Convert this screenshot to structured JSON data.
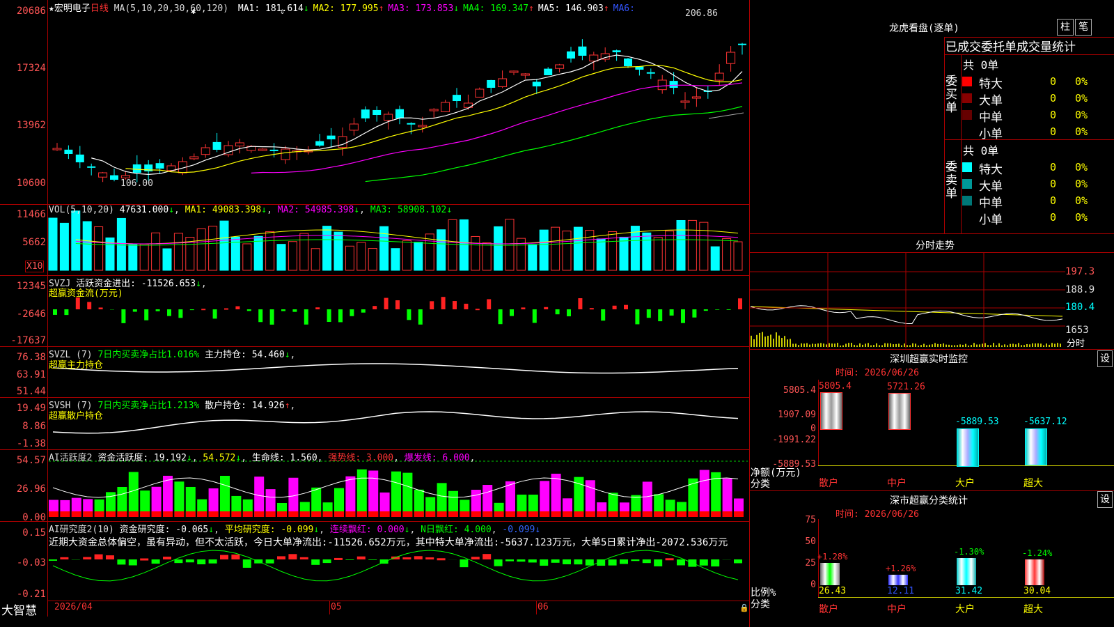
{
  "stock": {
    "star": "★",
    "name": "宏明电子",
    "period": "日线"
  },
  "ma_header": {
    "label": "MA(5,10,20,30,60,120)",
    "items": [
      {
        "text": "MA1: 181.614",
        "arrow": "↓",
        "color": "#ffffff",
        "arrow_color": "#00ff00"
      },
      {
        "text": "MA2: 177.995",
        "arrow": "↑",
        "color": "#ffff00",
        "arrow_color": "#ff3333"
      },
      {
        "text": "MA3: 173.853",
        "arrow": "↓",
        "color": "#ff00ff",
        "arrow_color": "#00ff00"
      },
      {
        "text": "MA4: 169.347",
        "arrow": "↑",
        "color": "#00ff00",
        "arrow_color": "#ff3333"
      },
      {
        "text": "MA5: 146.903",
        "arrow": "↑",
        "color": "#ffffff",
        "arrow_color": "#ff3333"
      },
      {
        "text": "MA6:",
        "arrow": "",
        "color": "#3355ff",
        "arrow_color": "#3355ff"
      }
    ]
  },
  "price_axis": [
    "20686",
    "17324",
    "13962",
    "10600"
  ],
  "price_high_label": "206.86",
  "price_low_label": "106.00",
  "vol": {
    "label": "VOL(5,10,20)",
    "value": "47631.000",
    "arrow": "↓",
    "ma1": "MA1: 49083.398",
    "ma1_arrow": "↓",
    "ma2": "MA2: 54985.398",
    "ma2_arrow": "↓",
    "ma3": "MA3: 58908.102",
    "ma3_arrow": "↓",
    "axis": [
      "11466",
      "5662"
    ],
    "unit": "X10"
  },
  "svzj": {
    "label": "SVZJ",
    "title": "活跃资金进出: -11526.653",
    "arrow": "↓",
    "sub": "超赢资金流(万元)",
    "axis": [
      "12345",
      "-2646",
      "-17637"
    ]
  },
  "svzl": {
    "label": "SVZL (7)",
    "ratio": "7日内买卖净占比1.016%",
    "hold": "主力持仓: 54.460",
    "arrow": "↓",
    "sub": "超赢主力持仓",
    "axis": [
      "76.38",
      "63.91",
      "51.44"
    ]
  },
  "svsh": {
    "label": "SVSH (7)",
    "ratio": "7日内买卖净占比1.213%",
    "hold": "散户持仓: 14.926",
    "arrow": "↑",
    "sub": "超赢散户持仓",
    "axis": [
      "19.49",
      "8.86",
      "-1.38"
    ]
  },
  "ai_active": {
    "label": "AI活跃度2",
    "v1": "资金活跃度: 19.192",
    "a1": "↓",
    "v2": "54.572",
    "a2": "↓",
    "v3": "生命线: 1.560",
    "strong": "强势线: 3.000",
    "burst": "爆发线: 6.000",
    "axis": [
      "54.57",
      "26.96",
      "0.00"
    ]
  },
  "ai_research": {
    "label": "AI研究度2(10)",
    "v1": "资金研究度: -0.065",
    "a1": "↓",
    "v2": "平均研究度: -0.099",
    "a2": "↓",
    "v3": "连续飘红: 0.000",
    "a3": "↓",
    "v4": "N日飘红: 4.000",
    "v5": "-0.099",
    "a5": "↓",
    "desc": "近期大资金总体偏空，虽有异动，但不太活跃，今日大单净流出:-11526.652万元，其中特大单净流出:-5637.123万元，大单5日累计净出-2072.536万元",
    "axis": [
      "0.15",
      "-0.03",
      "-0.21"
    ]
  },
  "bottom": {
    "brand": "大智慧",
    "dates": [
      "2026/04",
      "05",
      "06"
    ]
  },
  "longhu": {
    "title": "龙虎看盘(逐单)",
    "tabs": [
      "柱",
      "笔"
    ],
    "header": "已成交委托单成交量统计",
    "buy": {
      "side": "委买单",
      "total": "共 0单",
      "rows": [
        {
          "name": "特大",
          "val": "0",
          "pct": "0%",
          "color": "#ff0000"
        },
        {
          "name": "大单",
          "val": "0",
          "pct": "0%",
          "color": "#880000"
        },
        {
          "name": "中单",
          "val": "0",
          "pct": "0%",
          "color": "#660000"
        },
        {
          "name": "小单",
          "val": "0",
          "pct": "0%",
          "color": "#000000"
        }
      ]
    },
    "sell": {
      "side": "委卖单",
      "total": "共 0单",
      "rows": [
        {
          "name": "特大",
          "val": "0",
          "pct": "0%",
          "color": "#00ffff"
        },
        {
          "name": "大单",
          "val": "0",
          "pct": "0%",
          "color": "#009999"
        },
        {
          "name": "中单",
          "val": "0",
          "pct": "0%",
          "color": "#007777"
        },
        {
          "name": "小单",
          "val": "0",
          "pct": "0%",
          "color": "#000000"
        }
      ]
    }
  },
  "fenshi": {
    "title": "分时走势",
    "axis": [
      "197.3",
      "188.9",
      "180.4",
      "1653"
    ],
    "unit": "分时"
  },
  "monitor": {
    "title": "深圳超赢实时监控",
    "set": "设",
    "time": "时间: 2026/06/26",
    "axis": [
      "5805.4",
      "1907.09",
      "0",
      "-1991.22",
      "-5889.53"
    ],
    "ylabel": "净额(万元)",
    "xlabel": "分类",
    "cats": [
      "散户",
      "中户",
      "大户",
      "超大"
    ],
    "cat_colors": [
      "#ff3333",
      "#ff3333",
      "#ffff00",
      "#ffff00"
    ],
    "values": [
      "5805.4",
      "5721.26",
      "-5889.53",
      "-5637.12"
    ]
  },
  "class_stat": {
    "title": "深市超赢分类统计",
    "set": "设",
    "time": "时间: 2026/06/26",
    "axis": [
      "75",
      "50",
      "25",
      "0"
    ],
    "ylabel": "比例%",
    "xlabel": "分类",
    "cats": [
      "散户",
      "中户",
      "大户",
      "超大"
    ],
    "values": [
      "26.43",
      "12.11",
      "31.42",
      "30.04"
    ],
    "changes": [
      "+1.28%",
      "+1.26%",
      "-1.30%",
      "-1.24%"
    ]
  },
  "chart_data": [
    {
      "type": "bar",
      "title": "深圳超赢实时监控",
      "categories": [
        "散户",
        "中户",
        "大户",
        "超大"
      ],
      "values": [
        5805.4,
        5721.26,
        -5889.53,
        -5637.12
      ],
      "ylabel": "净额(万元)",
      "xlabel": "分类",
      "ylim": [
        -5889.53,
        5805.4
      ]
    },
    {
      "type": "bar",
      "title": "深市超赢分类统计",
      "categories": [
        "散户",
        "中户",
        "大户",
        "超大"
      ],
      "values": [
        26.43,
        12.11,
        31.42,
        30.04
      ],
      "ylabel": "比例%",
      "xlabel": "分类",
      "ylim": [
        0,
        75
      ]
    },
    {
      "type": "line",
      "title": "宏明电子 日线",
      "ylim": [
        106.0,
        206.86
      ],
      "labels": [
        "106.00",
        "206.86"
      ]
    }
  ]
}
